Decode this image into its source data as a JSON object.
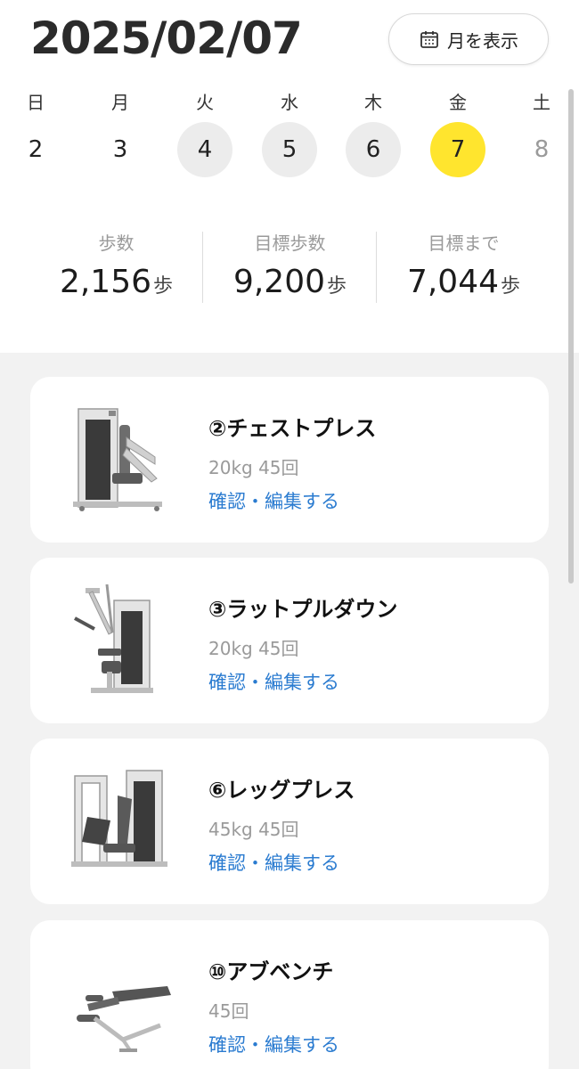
{
  "header": {
    "date": "2025/02/07",
    "month_button_label": "月を表示"
  },
  "week": [
    {
      "name": "日",
      "date": "2",
      "state": "plain"
    },
    {
      "name": "月",
      "date": "3",
      "state": "plain"
    },
    {
      "name": "火",
      "date": "4",
      "state": "done"
    },
    {
      "name": "水",
      "date": "5",
      "state": "done"
    },
    {
      "name": "木",
      "date": "6",
      "state": "done"
    },
    {
      "name": "金",
      "date": "7",
      "state": "today"
    },
    {
      "name": "土",
      "date": "8",
      "state": "future"
    }
  ],
  "stats": [
    {
      "label": "歩数",
      "value": "2,156",
      "unit": "歩"
    },
    {
      "label": "目標歩数",
      "value": "9,200",
      "unit": "歩"
    },
    {
      "label": "目標まで",
      "value": "7,044",
      "unit": "歩"
    }
  ],
  "workouts": [
    {
      "name": "②チェストプレス",
      "detail": "20kg 45回",
      "link": "確認・編集する",
      "icon": "chest-press-machine-icon"
    },
    {
      "name": "③ラットプルダウン",
      "detail": "20kg 45回",
      "link": "確認・編集する",
      "icon": "lat-pulldown-machine-icon"
    },
    {
      "name": "⑥レッグプレス",
      "detail": "45kg 45回",
      "link": "確認・編集する",
      "icon": "leg-press-machine-icon"
    },
    {
      "name": "⑩アブベンチ",
      "detail": "45回",
      "link": "確認・編集する",
      "icon": "ab-bench-icon"
    }
  ],
  "colors": {
    "today_highlight": "#ffe52e",
    "done_highlight": "#ececec",
    "link": "#2a7bd0",
    "list_background": "#f2f2f2"
  }
}
